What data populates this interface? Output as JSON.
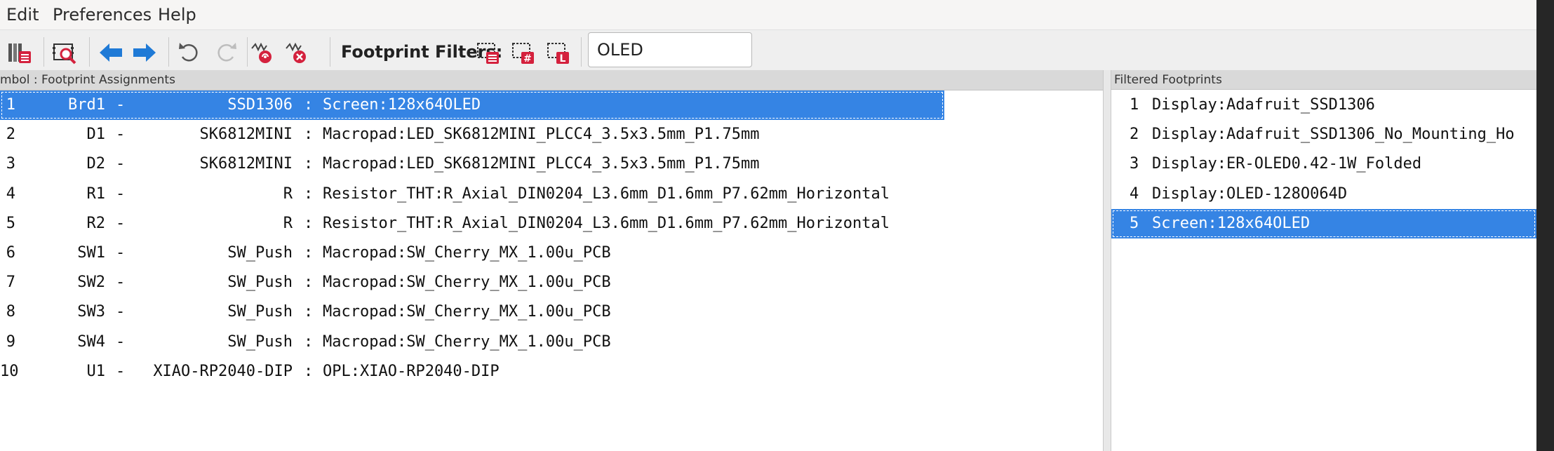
{
  "menu": [
    "Edit",
    "Preferences",
    "Help"
  ],
  "toolbar": {
    "filters_label": "Footprint Filters:",
    "filter_value": "OLED",
    "icons": [
      "library-table-icon",
      "footprint-viewer-icon",
      "previous-icon",
      "next-icon",
      "undo-icon",
      "redo-icon",
      "auto-associate-icon",
      "delete-associations-icon",
      "filter-by-keywords-icon",
      "filter-by-pin-count-icon",
      "filter-by-library-icon"
    ]
  },
  "left_pane": {
    "header": "mbol : Footprint Assignments",
    "rows": [
      {
        "num": "1",
        "ref": "Brd1",
        "dash": "-",
        "value": "SSD1306",
        "colon": ":",
        "footprint": "Screen:128x64OLED",
        "selected": true
      },
      {
        "num": "2",
        "ref": "D1",
        "dash": "-",
        "value": "SK6812MINI",
        "colon": ":",
        "footprint": "Macropad:LED_SK6812MINI_PLCC4_3.5x3.5mm_P1.75mm",
        "selected": false
      },
      {
        "num": "3",
        "ref": "D2",
        "dash": "-",
        "value": "SK6812MINI",
        "colon": ":",
        "footprint": "Macropad:LED_SK6812MINI_PLCC4_3.5x3.5mm_P1.75mm",
        "selected": false
      },
      {
        "num": "4",
        "ref": "R1",
        "dash": "-",
        "value": "R",
        "colon": ":",
        "footprint": "Resistor_THT:R_Axial_DIN0204_L3.6mm_D1.6mm_P7.62mm_Horizontal",
        "selected": false
      },
      {
        "num": "5",
        "ref": "R2",
        "dash": "-",
        "value": "R",
        "colon": ":",
        "footprint": "Resistor_THT:R_Axial_DIN0204_L3.6mm_D1.6mm_P7.62mm_Horizontal",
        "selected": false
      },
      {
        "num": "6",
        "ref": "SW1",
        "dash": "-",
        "value": "SW_Push",
        "colon": ":",
        "footprint": "Macropad:SW_Cherry_MX_1.00u_PCB",
        "selected": false
      },
      {
        "num": "7",
        "ref": "SW2",
        "dash": "-",
        "value": "SW_Push",
        "colon": ":",
        "footprint": "Macropad:SW_Cherry_MX_1.00u_PCB",
        "selected": false
      },
      {
        "num": "8",
        "ref": "SW3",
        "dash": "-",
        "value": "SW_Push",
        "colon": ":",
        "footprint": "Macropad:SW_Cherry_MX_1.00u_PCB",
        "selected": false
      },
      {
        "num": "9",
        "ref": "SW4",
        "dash": "-",
        "value": "SW_Push",
        "colon": ":",
        "footprint": "Macropad:SW_Cherry_MX_1.00u_PCB",
        "selected": false
      },
      {
        "num": "10",
        "ref": "U1",
        "dash": "-",
        "value": "XIAO-RP2040-DIP",
        "colon": ":",
        "footprint": "OPL:XIAO-RP2040-DIP",
        "selected": false
      }
    ]
  },
  "right_pane": {
    "header": "Filtered Footprints",
    "rows": [
      {
        "num": "1",
        "name": "Display:Adafruit_SSD1306",
        "selected": false
      },
      {
        "num": "2",
        "name": "Display:Adafruit_SSD1306_No_Mounting_Ho",
        "selected": false
      },
      {
        "num": "3",
        "name": "Display:ER-OLED0.42-1W_Folded",
        "selected": false
      },
      {
        "num": "4",
        "name": "Display:OLED-128O064D",
        "selected": false
      },
      {
        "num": "5",
        "name": "Screen:128x64OLED",
        "selected": true
      }
    ]
  },
  "colors": {
    "selection": "#3584e4",
    "arrow_blue": "#1f7ad6",
    "icon_red": "#d4213d"
  }
}
